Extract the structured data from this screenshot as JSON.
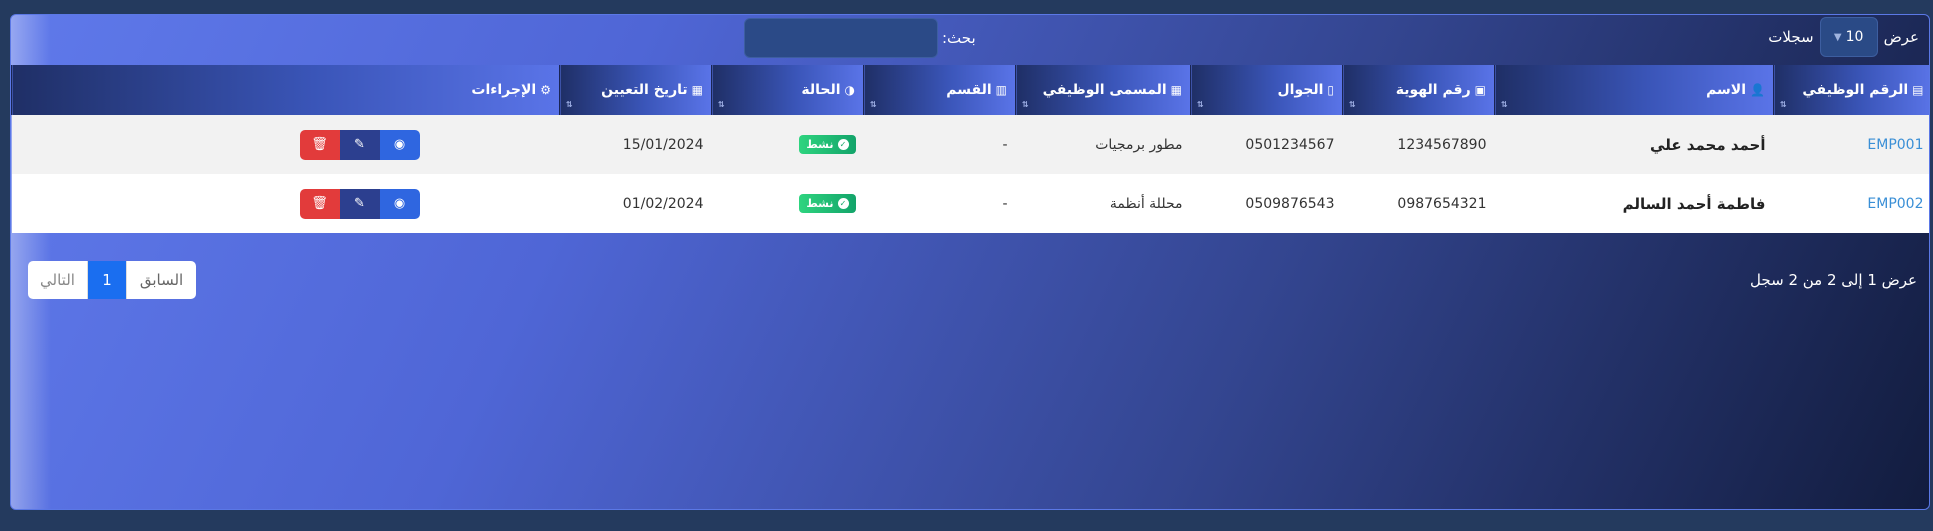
{
  "length": {
    "prefix": "عرض",
    "value": "10",
    "suffix": "سجلات"
  },
  "search": {
    "label": "بحث:",
    "value": ""
  },
  "columns": [
    {
      "label": "الرقم الوظيفي",
      "icon": "id-card-icon",
      "glyph": "▤"
    },
    {
      "label": "الاسم",
      "icon": "user-icon",
      "glyph": "👤"
    },
    {
      "label": "رقم الهوية",
      "icon": "id-badge-icon",
      "glyph": "▣"
    },
    {
      "label": "الجوال",
      "icon": "mobile-icon",
      "glyph": "▯"
    },
    {
      "label": "المسمى الوظيفي",
      "icon": "briefcase-icon",
      "glyph": "▦"
    },
    {
      "label": "القسم",
      "icon": "building-icon",
      "glyph": "▥"
    },
    {
      "label": "الحالة",
      "icon": "toggle-icon",
      "glyph": "◑"
    },
    {
      "label": "تاريخ التعيين",
      "icon": "calendar-icon",
      "glyph": "▦"
    },
    {
      "label": "الإجراءات",
      "icon": "gears-icon",
      "glyph": "⚙"
    }
  ],
  "rows": [
    {
      "id": "EMP001",
      "name": "أحمد محمد علي",
      "national_id": "1234567890",
      "mobile": "0501234567",
      "title": "مطور برمجيات",
      "department": "-",
      "status": "نشط",
      "hire_date": "15/01/2024"
    },
    {
      "id": "EMP002",
      "name": "فاطمة أحمد السالم",
      "national_id": "0987654321",
      "mobile": "0509876543",
      "title": "محللة أنظمة",
      "department": "-",
      "status": "نشط",
      "hire_date": "01/02/2024"
    }
  ],
  "icons": {
    "view": "eye-icon",
    "edit": "edit-icon",
    "delete": "trash-icon",
    "status_check": "check-circle-icon"
  },
  "info": "عرض 1 إلى 2 من 2 سجل",
  "pagination": {
    "previous": "السابق",
    "current": "1",
    "next": "التالي"
  },
  "colors": {
    "primary": "#5f79ea",
    "success": "#13a46a",
    "danger": "#e23b3b",
    "link": "#3a8fd6",
    "page_active": "#1a6ef0"
  }
}
